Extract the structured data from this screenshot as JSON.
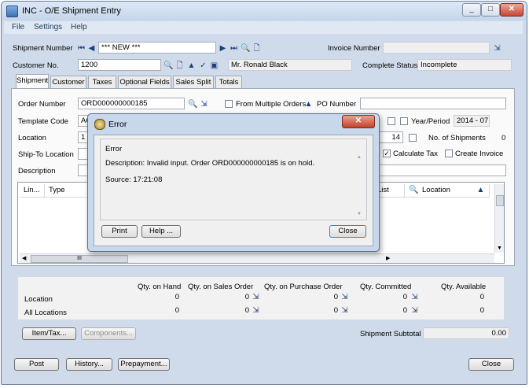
{
  "window": {
    "title": "INC - O/E Shipment Entry",
    "min": "_",
    "max": "□",
    "close": "✕"
  },
  "menu": [
    "File",
    "Settings",
    "Help"
  ],
  "header": {
    "shipment_number_label": "Shipment Number",
    "shipment_number_value": "*** NEW ***",
    "invoice_number_label": "Invoice Number",
    "invoice_number_value": "",
    "customer_no_label": "Customer No.",
    "customer_no_value": "1200",
    "customer_name": "Mr. Ronald Black",
    "complete_status_label": "Complete Status",
    "complete_status_value": "Incomplete"
  },
  "tabs": [
    "Shipment",
    "Customer",
    "Taxes",
    "Optional Fields",
    "Sales Split",
    "Totals"
  ],
  "shipment": {
    "order_number_label": "Order Number",
    "order_number_value": "ORD000000000185",
    "from_multiple_orders_label": "From Multiple Orders",
    "po_number_label": "PO Number",
    "po_number_value": "",
    "template_code_label": "Template Code",
    "template_code_value": "AC",
    "year_period_label": "Year/Period",
    "year_period_value": "2014 - 07",
    "location_label": "Location",
    "location_value": "1",
    "shipment_date_partial": "14",
    "no_of_shipments_label": "No. of Shipments",
    "no_of_shipments_value": "0",
    "ship_to_location_label": "Ship-To Location",
    "calculate_tax_label": "Calculate Tax",
    "create_invoice_label": "Create Invoice",
    "description_label": "Description"
  },
  "grid": {
    "columns": [
      "Lin...",
      "Type",
      "List",
      "Location"
    ],
    "scroll_thumb": "III"
  },
  "quantities": {
    "headers": [
      "Qty. on Hand",
      "Qty. on Sales Order",
      "Qty. on Purchase Order",
      "Qty. Committed",
      "Qty. Available"
    ],
    "rows": [
      {
        "label": "Location",
        "values": [
          "0",
          "0",
          "0",
          "0",
          "0"
        ]
      },
      {
        "label": "All Locations",
        "values": [
          "0",
          "0",
          "0",
          "0",
          "0"
        ]
      }
    ]
  },
  "buttons": {
    "item_tax": "Item/Tax...",
    "components": "Components...",
    "post": "Post",
    "history": "History...",
    "prepayment": "Prepayment...",
    "close": "Close"
  },
  "subtotal": {
    "label": "Shipment Subtotal",
    "value": "0.00"
  },
  "dialog": {
    "title": "Error",
    "heading": "Error",
    "description": "Description: Invalid input. Order ORD000000000185 is on hold.",
    "source": "Source:  17:21:08",
    "print": "Print",
    "help": "Help ...",
    "close": "Close",
    "close_x": "✕"
  }
}
